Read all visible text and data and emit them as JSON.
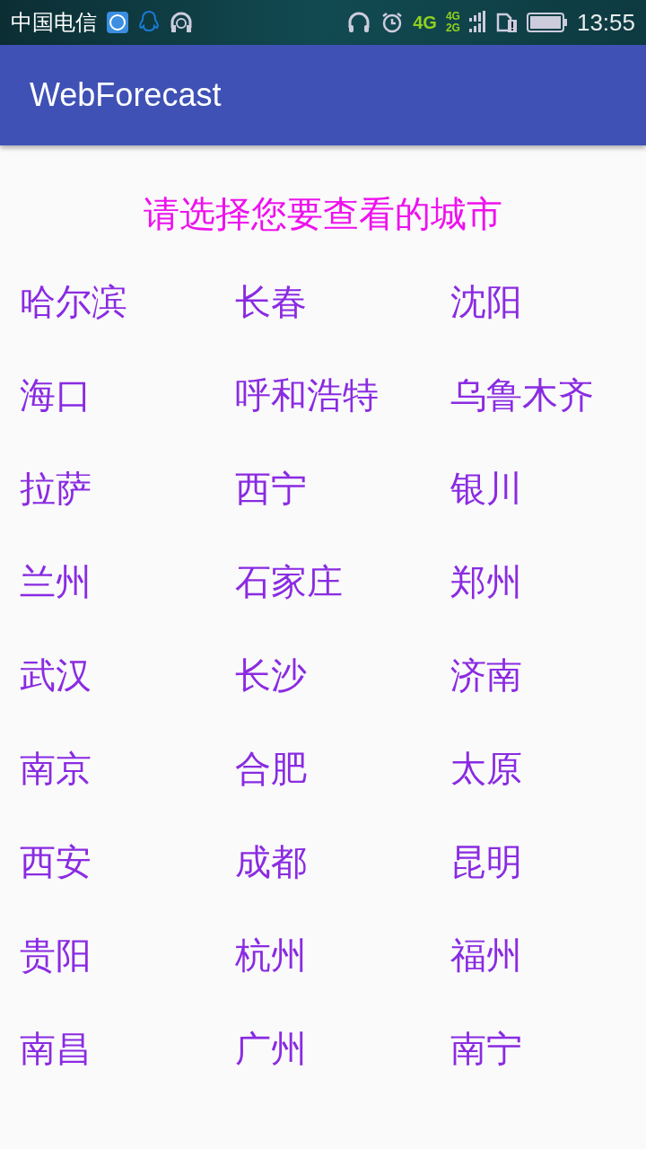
{
  "status_bar": {
    "carrier": "中国电信",
    "network": "4G",
    "network_secondary": [
      "4G",
      "2G"
    ],
    "time": "13:55"
  },
  "app_bar": {
    "title": "WebForecast"
  },
  "prompt": "请选择您要查看的城市",
  "cities": [
    "哈尔滨",
    "长春",
    "沈阳",
    "海口",
    "呼和浩特",
    "乌鲁木齐",
    "拉萨",
    "西宁",
    "银川",
    "兰州",
    "石家庄",
    "郑州",
    "武汉",
    "长沙",
    "济南",
    "南京",
    "合肥",
    "太原",
    "西安",
    "成都",
    "昆明",
    "贵阳",
    "杭州",
    "福州",
    "南昌",
    "广州",
    "南宁"
  ]
}
